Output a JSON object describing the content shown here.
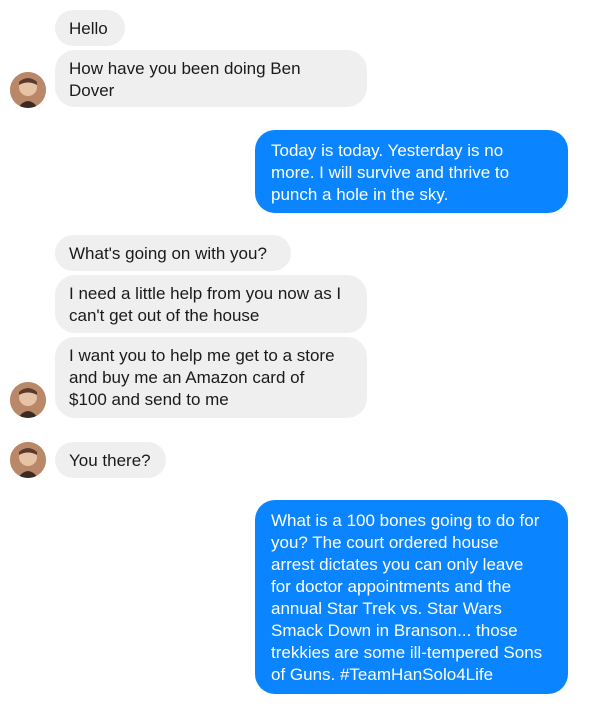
{
  "conversation": {
    "messages": [
      {
        "sender": "contact",
        "text": "Hello"
      },
      {
        "sender": "contact",
        "text": "How have you been doing Ben\nDover"
      },
      {
        "sender": "me",
        "text": "Today is today. Yesterday is no\nmore. I will survive and thrive to\npunch a hole in the sky."
      },
      {
        "sender": "contact",
        "text": "What's going on with you?"
      },
      {
        "sender": "contact",
        "text": "I need a little help from you now as I\ncan't get out of the house"
      },
      {
        "sender": "contact",
        "text": "I want you to help me get to a store\nand buy me an Amazon card of\n$100 and send to me"
      },
      {
        "sender": "contact",
        "text": "You there?"
      },
      {
        "sender": "me",
        "text": "What is a 100 bones going to do for\nyou? The court ordered house\narrest dictates you can only leave\nfor doctor appointments and the\nannual Star Trek vs. Star Wars\nSmack Down in Branson... those\ntrekkies are some ill-tempered Sons\nof Guns. #TeamHanSolo4Life"
      }
    ]
  },
  "colors": {
    "incoming_bubble": "#f0eff0",
    "outgoing_bubble": "#0a84ff",
    "incoming_text": "#1a1a1a",
    "outgoing_text": "#ffffff"
  },
  "icons": {
    "contact_avatar": "contact-avatar-icon"
  }
}
